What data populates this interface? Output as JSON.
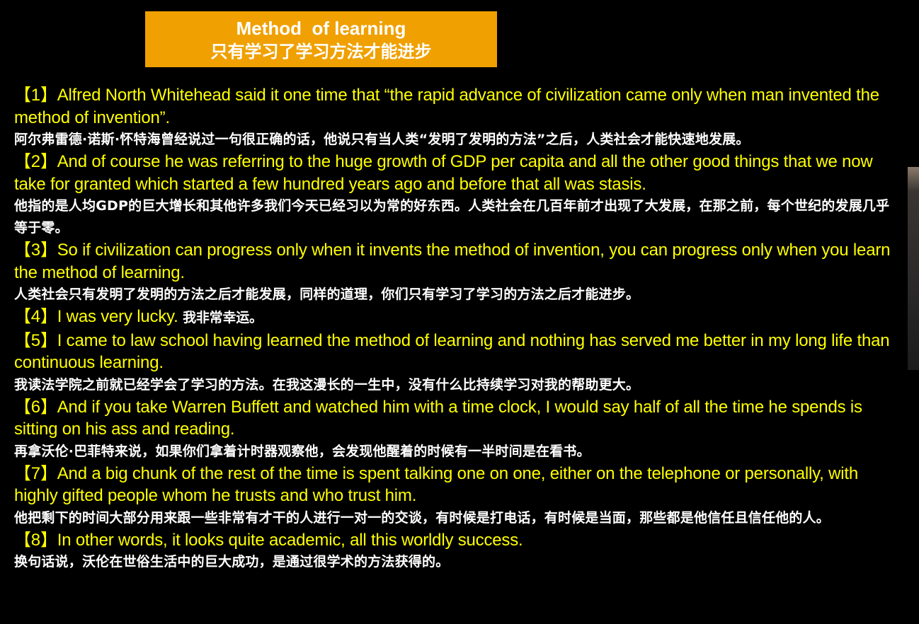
{
  "title": {
    "en": "Method  of learning",
    "zh": "只有学习了学习方法才能进步"
  },
  "items": [
    {
      "en": "【1】Alfred North Whitehead said it one time that “the rapid advance of civilization came only when man invented the method of invention”.",
      "zh": "阿尔弗雷德·诺斯·怀特海曾经说过一句很正确的话，他说只有当人类“发明了发明的方法”之后，人类社会才能快速地发展。"
    },
    {
      "en": "【2】And of course he was referring to the huge growth of GDP per capita and all the other good things that we now take for granted which started a few hundred years ago and before that all was stasis.",
      "zh": "他指的是人均GDP的巨大增长和其他许多我们今天已经习以为常的好东西。人类社会在几百年前才出现了大发展，在那之前，每个世纪的发展几乎等于零。"
    },
    {
      "en": "【3】So if civilization can progress only when it invents the method of invention, you can progress only when you learn the method of learning.",
      "zh": "人类社会只有发明了发明的方法之后才能发展，同样的道理，你们只有学习了学习的方法之后才能进步。"
    },
    {
      "en": "【4】I was very lucky. ",
      "inline_zh": "我非常幸运。"
    },
    {
      "en": "【5】I came to law school having learned the method of learning and nothing has served me better in my long life than continuous learning.",
      "zh": "我读法学院之前就已经学会了学习的方法。在我这漫长的一生中，没有什么比持续学习对我的帮助更大。"
    },
    {
      "en": "【6】And if you take Warren Buffett and watched him with a time clock, I would say half of all the time he spends is sitting on his ass and reading.",
      "zh": "再拿沃伦·巴菲特来说，如果你们拿着计时器观察他，会发现他醒着的时候有一半时间是在看书。"
    },
    {
      "en": "【7】And a big chunk of the rest of the time is spent talking one on one, either on the telephone or personally, with highly gifted people whom he trusts and who trust him.",
      "zh": "他把剩下的时间大部分用来跟一些非常有才干的人进行一对一的交谈，有时候是打电话，有时候是当面，那些都是他信任且信任他的人。"
    },
    {
      "en": "【8】In other words, it looks quite academic, all this worldly success.",
      "zh": "换句话说，沃伦在世俗生活中的巨大成功，是通过很学术的方法获得的。"
    }
  ],
  "colors": {
    "background": "#000000",
    "title_bg": "#f0a000",
    "english_text": "#ffff00",
    "chinese_text": "#ffffff"
  }
}
